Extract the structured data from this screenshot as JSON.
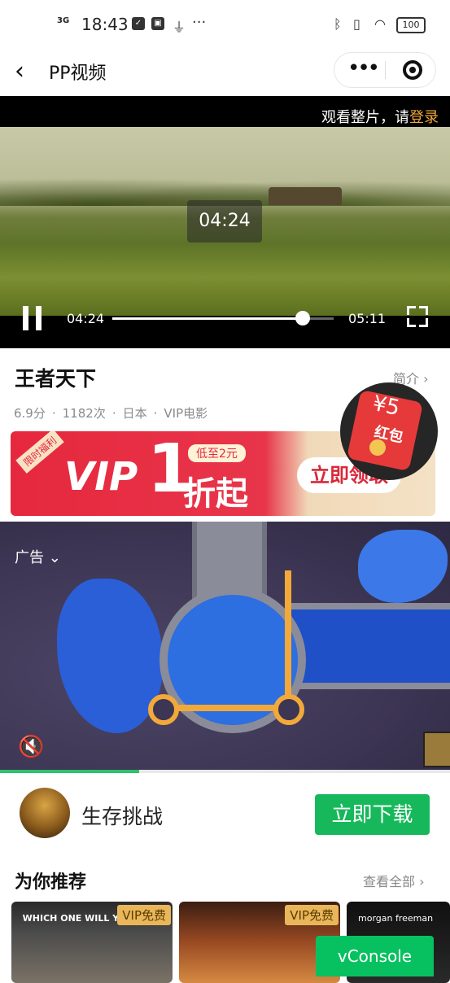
{
  "status_bar": {
    "network": "3G",
    "time": "18:43",
    "battery": "100",
    "more": "···"
  },
  "nav": {
    "back_icon": "chevron-left-icon",
    "title": "PP视频"
  },
  "player": {
    "login_prompt": "观看整片，请",
    "login_link": "登录",
    "time_popup": "04:24",
    "current_time": "04:24",
    "total_time": "05:11",
    "progress": 0.86
  },
  "movie": {
    "title": "王者天下",
    "intro_link": "简介 ›",
    "rating": "6.9分",
    "plays": "1182次",
    "region": "日本",
    "category": "VIP电影"
  },
  "vip_banner": {
    "corner_tag": "限时福利",
    "vip": "VIP",
    "one": "1",
    "low_price": "低至2元",
    "discount": "折起",
    "cta": "立即领取"
  },
  "red_packet": {
    "amount": "¥5",
    "label": "红包"
  },
  "ad": {
    "label": "广告",
    "progress": 0.31,
    "app_name": "生存挑战",
    "download_label": "立即下载"
  },
  "recommend": {
    "title": "为你推荐",
    "see_all": "查看全部 ›",
    "items": [
      {
        "caption": "WHICH ONE WILL YOU GET?",
        "badge": "VIP免费"
      },
      {
        "caption": "",
        "badge": "VIP免费"
      },
      {
        "caption": "morgan freeman",
        "badge": ""
      }
    ]
  },
  "vconsole_label": "vConsole",
  "colors": {
    "accent_green": "#17b85b",
    "login_orange": "#f0a83a",
    "vip_red": "#e6283e"
  }
}
